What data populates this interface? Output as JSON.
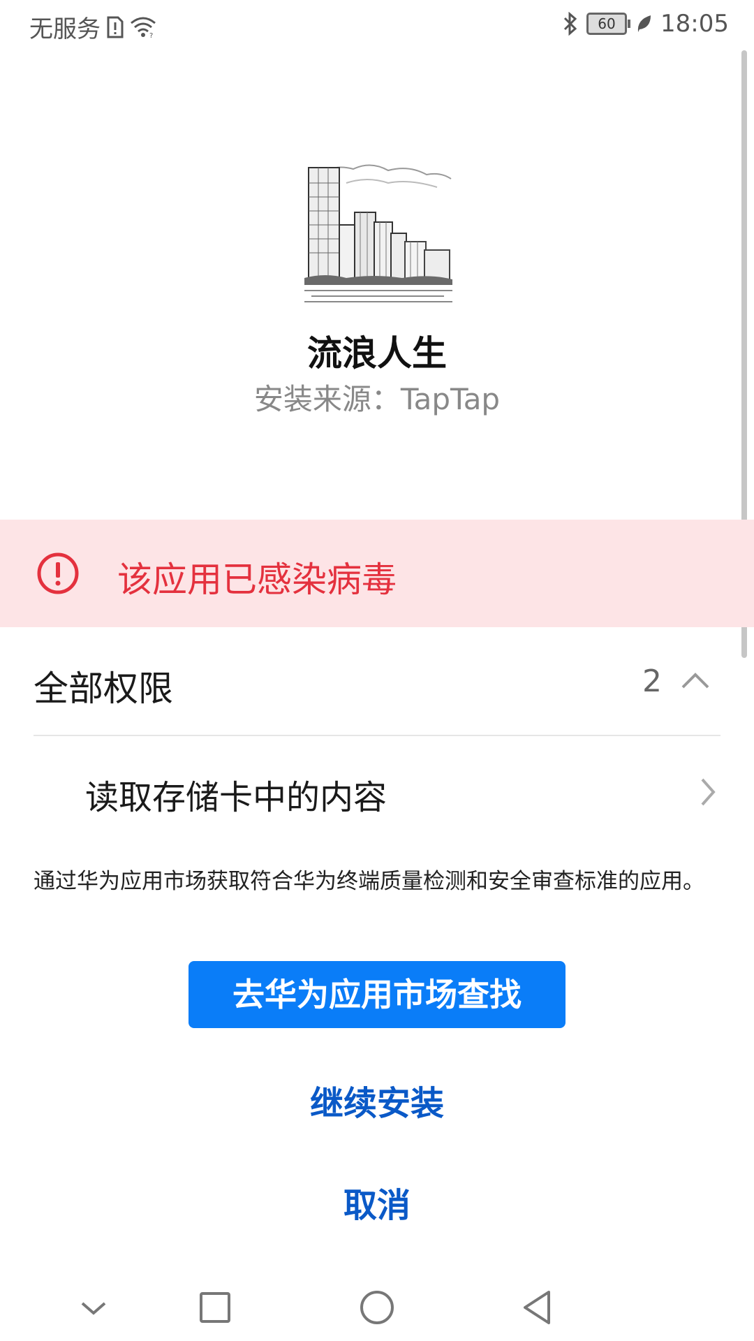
{
  "status_bar": {
    "carrier": "无服务",
    "battery": "60",
    "time": "18:05"
  },
  "app": {
    "name": "流浪人生",
    "source": "安装来源：TapTap"
  },
  "warning": {
    "text": "该应用已感染病毒",
    "color": "#e4313e"
  },
  "permissions": {
    "title": "全部权限",
    "count": "2",
    "items": [
      {
        "label": "读取存储卡中的内容"
      }
    ]
  },
  "info": {
    "text": "通过华为应用市场获取符合华为终端质量检测和安全审查标准的应用。"
  },
  "actions": {
    "market_label": "去华为应用市场查找",
    "continue_label": "继续安装",
    "cancel_label": "取消"
  },
  "colors": {
    "primary_button": "#0a7df8",
    "link": "#0a59c7",
    "warning_bg": "#fde4e6"
  },
  "icons": {
    "status_left": [
      "sim-alert-icon",
      "wifi-icon"
    ],
    "status_right": [
      "bluetooth-icon",
      "battery-icon",
      "leaf-icon"
    ],
    "nav": [
      "chevron-down-icon",
      "recent-apps-icon",
      "home-icon",
      "back-icon"
    ]
  }
}
